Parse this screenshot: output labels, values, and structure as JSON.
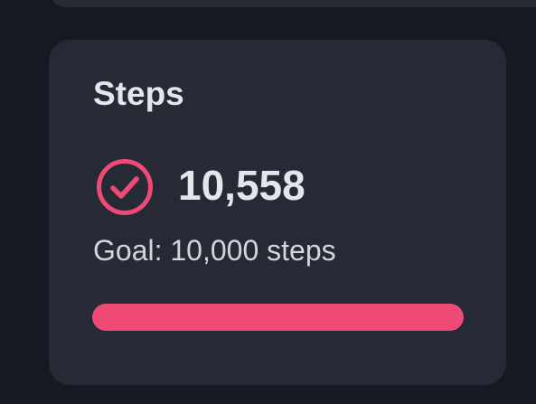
{
  "card": {
    "title": "Steps",
    "steps_value": "10,558",
    "goal_text": "Goal: 10,000 steps",
    "status_icon": "check-circle-icon",
    "progress_fraction": 1.0
  },
  "colors": {
    "accent": "#ef4a76",
    "card_background": "#252a35",
    "page_background": "#161922",
    "text_primary": "#e4e6eb"
  }
}
